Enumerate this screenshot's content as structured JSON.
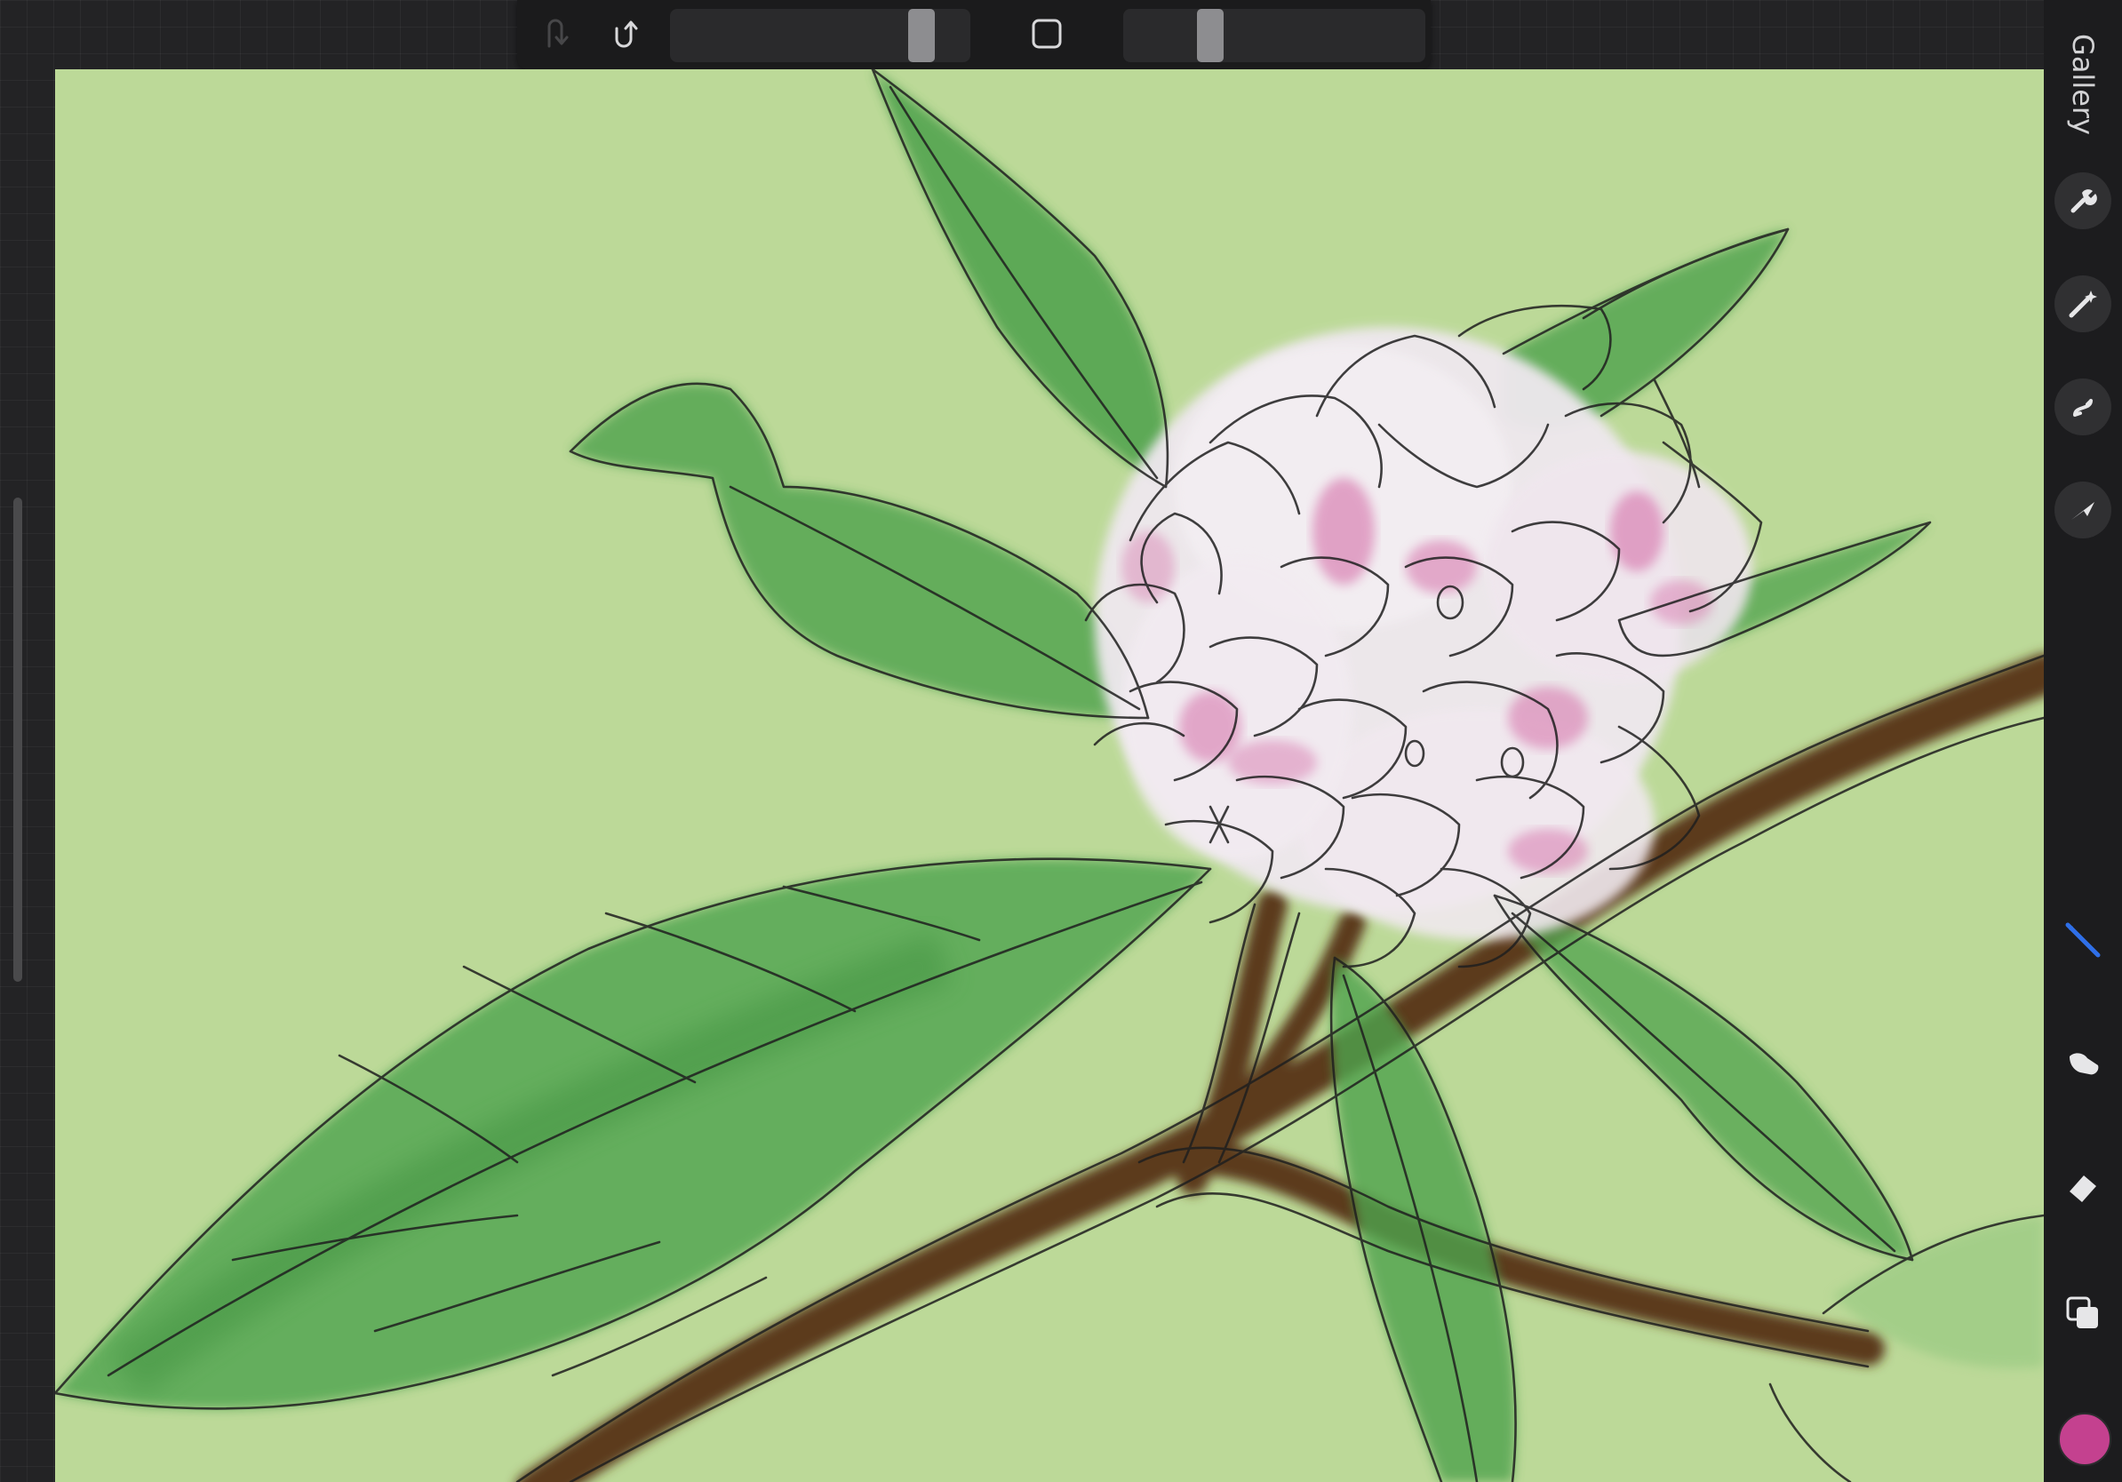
{
  "app": {
    "gallery_label": "Gallery"
  },
  "top_toolbar": {
    "brush_size_level": 0.88,
    "opacity_level": 0.26,
    "undo_enabled": false,
    "icons": {
      "undo": "undo-arrow-icon",
      "redo": "redo-arrow-icon",
      "modify": "square-modify-icon"
    }
  },
  "right_toolbar": {
    "actions_icons": [
      "wrench-icon",
      "magic-wand-icon",
      "selection-s-icon",
      "transform-arrow-icon"
    ],
    "tools_icons": [
      "brush-icon",
      "smudge-icon",
      "eraser-icon",
      "layers-icon"
    ],
    "active_tool": "brush-icon",
    "current_color": "#c4418f"
  },
  "colors": {
    "canvas_background": "#bcd998",
    "leaf_green": "#3f9a43",
    "branch_brown": "#5a3a1e",
    "flower_pink": "#d56fa9",
    "accent_blue": "#2f6fe8"
  }
}
